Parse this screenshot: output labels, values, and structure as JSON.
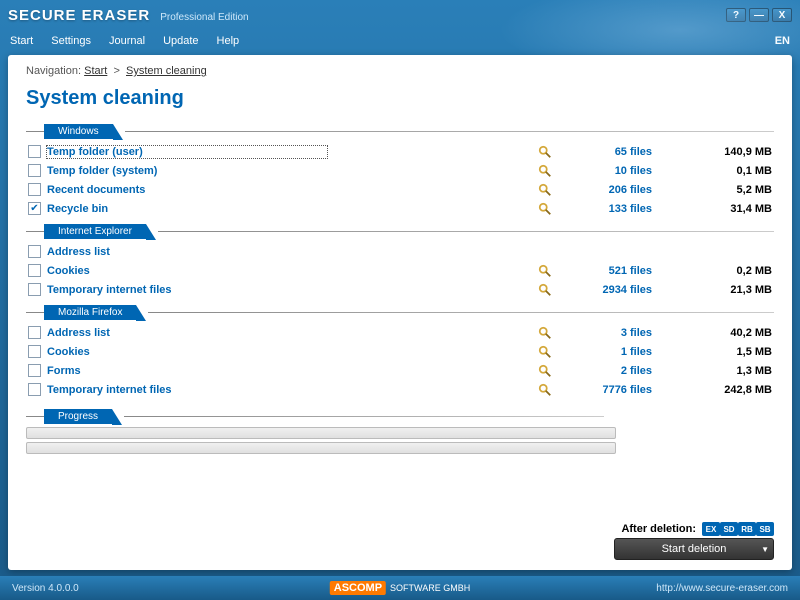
{
  "app": {
    "title": "SECURE ERASER",
    "edition": "Professional Edition"
  },
  "menu": {
    "items": [
      "Start",
      "Settings",
      "Journal",
      "Update",
      "Help"
    ],
    "lang": "EN"
  },
  "breadcrumb": {
    "label": "Navigation:",
    "items": [
      "Start",
      "System cleaning"
    ]
  },
  "page_title": "System cleaning",
  "sections": [
    {
      "title": "Windows",
      "rows": [
        {
          "label": "Temp folder (user)",
          "checked": false,
          "selected": true,
          "files": "65 files",
          "size": "140,9 MB",
          "magnify": true
        },
        {
          "label": "Temp folder (system)",
          "checked": false,
          "files": "10 files",
          "size": "0,1 MB",
          "magnify": true
        },
        {
          "label": "Recent documents",
          "checked": false,
          "files": "206 files",
          "size": "5,2 MB",
          "magnify": true
        },
        {
          "label": "Recycle bin",
          "checked": true,
          "files": "133 files",
          "size": "31,4 MB",
          "magnify": true
        }
      ]
    },
    {
      "title": "Internet Explorer",
      "rows": [
        {
          "label": "Address list",
          "checked": false,
          "files": "",
          "size": "",
          "magnify": false
        },
        {
          "label": "Cookies",
          "checked": false,
          "files": "521 files",
          "size": "0,2 MB",
          "magnify": true
        },
        {
          "label": "Temporary internet files",
          "checked": false,
          "files": "2934 files",
          "size": "21,3 MB",
          "magnify": true
        }
      ]
    },
    {
      "title": "Mozilla Firefox",
      "rows": [
        {
          "label": "Address list",
          "checked": false,
          "files": "3 files",
          "size": "40,2 MB",
          "magnify": true
        },
        {
          "label": "Cookies",
          "checked": false,
          "files": "1 files",
          "size": "1,5 MB",
          "magnify": true
        },
        {
          "label": "Forms",
          "checked": false,
          "files": "2 files",
          "size": "1,3 MB",
          "magnify": true
        },
        {
          "label": "Temporary internet files",
          "checked": false,
          "files": "7776 files",
          "size": "242,8 MB",
          "magnify": true
        }
      ]
    }
  ],
  "progress_label": "Progress",
  "after_deletion": {
    "label": "After deletion:",
    "badges": [
      "EX",
      "SD",
      "RB",
      "SB"
    ]
  },
  "start_button": "Start deletion",
  "footer": {
    "version": "Version 4.0.0.0",
    "brand": "ASCOMP",
    "brand_sub": "SOFTWARE GMBH",
    "url": "http://www.secure-eraser.com"
  }
}
